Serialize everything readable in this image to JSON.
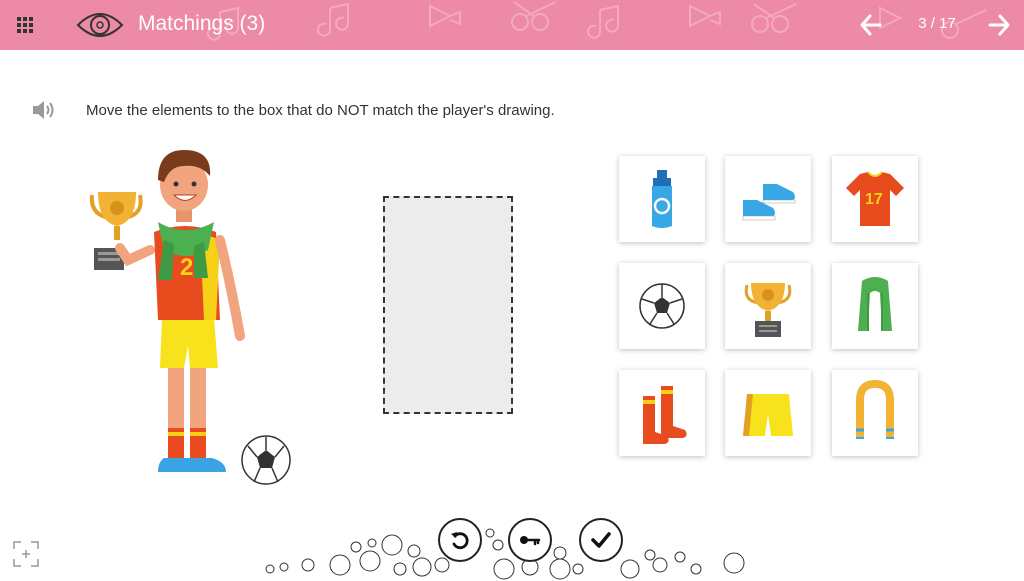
{
  "header": {
    "title": "Matchings (3)",
    "pager": "3 / 17",
    "background_color": "#ec8aa8"
  },
  "instruction": {
    "text": "Move the elements to the box that do NOT match the player's drawing."
  },
  "player": {
    "jersey_number": "2"
  },
  "items": [
    {
      "name": "water-bottle"
    },
    {
      "name": "sneakers"
    },
    {
      "name": "jersey-17",
      "label": "17"
    },
    {
      "name": "soccer-ball"
    },
    {
      "name": "trophy"
    },
    {
      "name": "green-towel"
    },
    {
      "name": "red-socks"
    },
    {
      "name": "yellow-shorts"
    },
    {
      "name": "yellow-scarf"
    }
  ],
  "controls": [
    {
      "name": "reset-button",
      "icon": "undo-icon"
    },
    {
      "name": "solution-button",
      "icon": "key-icon"
    },
    {
      "name": "check-button",
      "icon": "checkmark-icon"
    }
  ]
}
